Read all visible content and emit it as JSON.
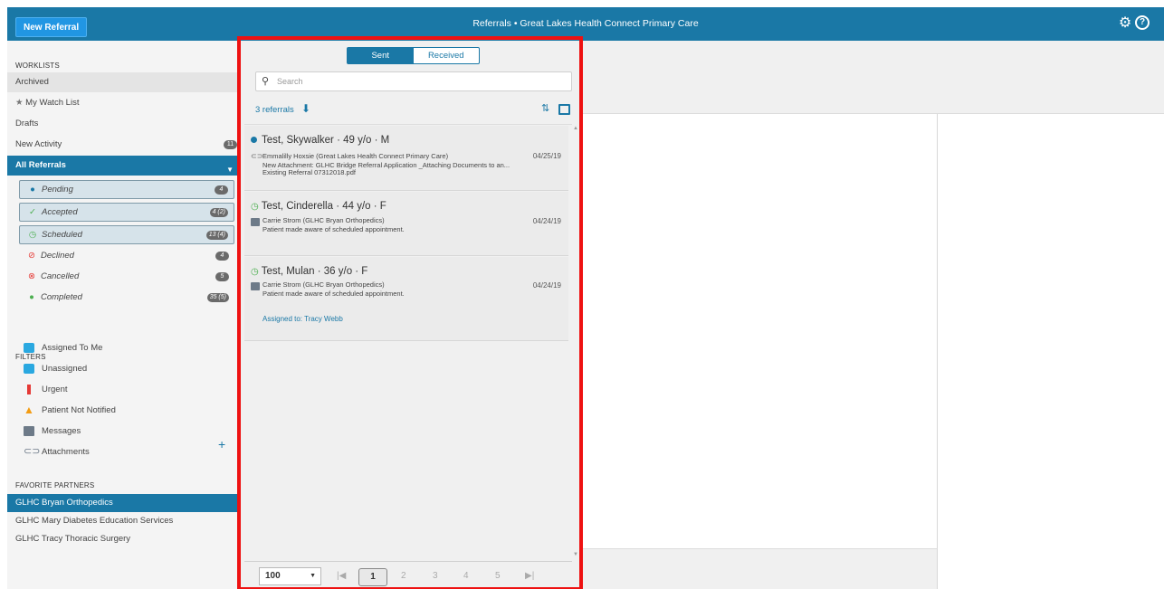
{
  "header": {
    "new_referral_label": "New Referral",
    "title": "Referrals • Great Lakes Health Connect Primary Care"
  },
  "sidebar": {
    "worklists_heading": "WORKLISTS",
    "worklists": [
      {
        "label": "Archived"
      },
      {
        "label": "My Watch List"
      },
      {
        "label": "Drafts"
      },
      {
        "label": "New Activity",
        "count": "11"
      },
      {
        "label": "All Referrals"
      }
    ],
    "statuses": [
      {
        "label": "Pending",
        "count": "4",
        "color": "#1a78a6"
      },
      {
        "label": "Accepted",
        "count": "4 (2)",
        "color": "#4caf50"
      },
      {
        "label": "Scheduled",
        "count": "13 (4)",
        "color": "#4caf50"
      },
      {
        "label": "Declined",
        "count": "4",
        "color": "#e53935"
      },
      {
        "label": "Cancelled",
        "count": "5",
        "color": "#e53935"
      },
      {
        "label": "Completed",
        "count": "35 (5)",
        "color": "#4caf50"
      }
    ],
    "filters_heading": "FILTERS",
    "filters": [
      {
        "label": "Assigned To Me",
        "icon": "assigned-user-icon",
        "color": "#2aa8e0"
      },
      {
        "label": "Unassigned",
        "icon": "unassigned-icon",
        "color": "#2aa8e0"
      },
      {
        "label": "Urgent",
        "icon": "urgent-icon",
        "color": "#e53935"
      },
      {
        "label": "Patient Not Notified",
        "icon": "warning-icon",
        "color": "#f39c12"
      },
      {
        "label": "Messages",
        "icon": "message-icon",
        "color": "#6d7a88"
      },
      {
        "label": "Attachments",
        "icon": "paperclip-icon",
        "color": "#6d7a88"
      }
    ],
    "partners_heading": "FAVORITE PARTNERS",
    "partners": [
      {
        "label": "GLHC Bryan Orthopedics"
      },
      {
        "label": "GLHC Mary Diabetes Education Services"
      },
      {
        "label": "GLHC Tracy Thoracic Surgery"
      }
    ]
  },
  "list": {
    "tabs": {
      "sent": "Sent",
      "received": "Received"
    },
    "search_placeholder": "Search",
    "count_label": "3 referrals",
    "cards": [
      {
        "name": "Test, Skywalker · 49 y/o · M",
        "from": "Emmalilly Hoxsie (Great Lakes Health Connect Primary Care)",
        "date": "04/25/19",
        "line1": "New Attachment: GLHC Bridge Referral Application _Attaching Documents to an...",
        "line2": "Existing Referral 07312018.pdf"
      },
      {
        "name": "Test, Cinderella · 44 y/o · F",
        "from": "Carrie Strom (GLHC Bryan Orthopedics)",
        "date": "04/24/19",
        "line1": "Patient made aware of scheduled appointment."
      },
      {
        "name": "Test, Mulan · 36 y/o · F",
        "from": "Carrie Strom (GLHC Bryan Orthopedics)",
        "date": "04/24/19",
        "line1": "Patient made aware of scheduled appointment.",
        "assigned": "Assigned to: Tracy Webb"
      }
    ],
    "pager": {
      "page_size": "100",
      "pages": [
        "1",
        "2",
        "3",
        "4",
        "5"
      ],
      "current": "1"
    }
  },
  "colors": {
    "accent": "#1a78a6",
    "highlight_border": "#ee1111"
  }
}
